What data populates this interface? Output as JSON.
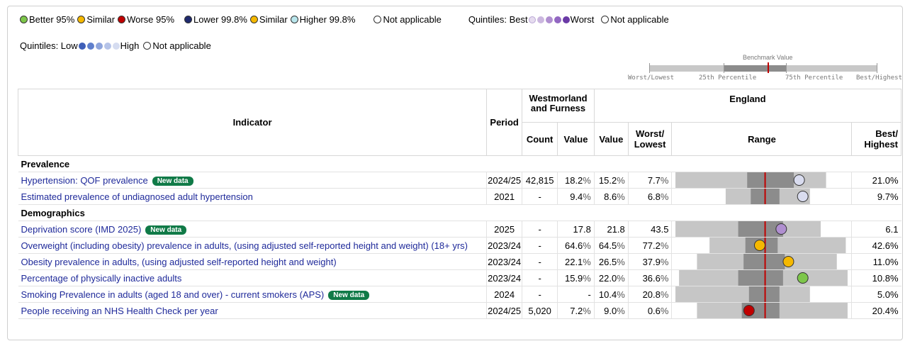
{
  "legend": {
    "row1": {
      "better": "Better 95%",
      "similar": "Similar",
      "worse": "Worse 95%",
      "lower": "Lower 99.8%",
      "similar2": "Similar",
      "higher": "Higher 99.8%",
      "not_applicable": "Not applicable",
      "quintiles_best_label": "Quintiles: Best",
      "quintiles_worst_label": "Worst",
      "not_applicable2": "Not applicable"
    },
    "row2": {
      "quintiles_low_label": "Quintiles: Low",
      "quintiles_high_label": "High",
      "not_applicable": "Not applicable"
    },
    "colors": {
      "better": "#7dc64a",
      "similar": "#f5b800",
      "worse": "#c00000",
      "lower": "#1f2a6e",
      "higher": "#b9e6ec",
      "best_quintiles": [
        "#e6dcef",
        "#cbb7df",
        "#b08fd0",
        "#9267c2",
        "#6a3aa6"
      ],
      "low_quintiles": [
        "#3f5fb8",
        "#5f7fcc",
        "#8fa5dc",
        "#b5c3e8",
        "#d5dcf0"
      ]
    }
  },
  "benchmark": {
    "title": "Benchmark Value",
    "worst": "Worst/Lowest",
    "p25": "25th Percentile",
    "p75": "75th Percentile",
    "best": "Best/Highest"
  },
  "headers": {
    "indicator": "Indicator",
    "period": "Period",
    "area": "Westmorland and Furness",
    "england": "England",
    "count": "Count",
    "value": "Value",
    "eng_value": "Value",
    "worst": "Worst/ Lowest",
    "range": "Range",
    "best": "Best/ Highest"
  },
  "new_data_label": "New data",
  "sections": [
    {
      "title": "Prevalence",
      "rows": [
        {
          "indicator": "Hypertension: QOF prevalence",
          "new": true,
          "period": "2024/25",
          "count": "42,815",
          "value": "18.2",
          "unit": "%",
          "eng": "15.2",
          "worst": "7.7",
          "best": "21.0",
          "dot": "#d9dcef",
          "range": {
            "outer": [
              0.02,
              0.86
            ],
            "inner": [
              0.42,
              0.68
            ],
            "mark": 0.52,
            "point": 0.71
          }
        },
        {
          "indicator": "Estimated prevalence of undiagnosed adult hypertension",
          "new": false,
          "period": "2021",
          "count": "-",
          "value": "9.4",
          "unit": "%",
          "eng": "8.6",
          "worst": "6.8",
          "best": "9.7",
          "dot": "#d9dcef",
          "range": {
            "outer": [
              0.3,
              0.77
            ],
            "inner": [
              0.44,
              0.6
            ],
            "mark": 0.52,
            "point": 0.73
          }
        }
      ]
    },
    {
      "title": "Demographics",
      "rows": [
        {
          "indicator": "Deprivation score (IMD 2025)",
          "new": true,
          "period": "2025",
          "count": "-",
          "value": "17.8",
          "unit": "",
          "eng": "21.8",
          "worst": "43.5",
          "best": "6.1",
          "dot": "#b08fd0",
          "range": {
            "outer": [
              0.02,
              0.83
            ],
            "inner": [
              0.37,
              0.62
            ],
            "mark": 0.52,
            "point": 0.61
          }
        },
        {
          "indicator": "Overweight (including obesity) prevalence in adults, (using adjusted self-reported height and weight) (18+ yrs)",
          "new": false,
          "period": "2023/24",
          "count": "-",
          "value": "64.6",
          "unit": "%",
          "eng": "64.5",
          "worst": "77.2",
          "best": "42.6",
          "dot": "#f5b800",
          "range": {
            "outer": [
              0.21,
              0.97
            ],
            "inner": [
              0.41,
              0.59
            ],
            "mark": 0.52,
            "point": 0.49
          }
        },
        {
          "indicator": "Obesity prevalence in adults, (using adjusted self-reported height and weight)",
          "new": false,
          "period": "2023/24",
          "count": "-",
          "value": "22.1",
          "unit": "%",
          "eng": "26.5",
          "worst": "37.9",
          "best": "11.0",
          "dot": "#f5b800",
          "range": {
            "outer": [
              0.14,
              0.92
            ],
            "inner": [
              0.4,
              0.63
            ],
            "mark": 0.52,
            "point": 0.65
          }
        },
        {
          "indicator": "Percentage of physically inactive adults",
          "new": false,
          "period": "2023/24",
          "count": "-",
          "value": "15.9",
          "unit": "%",
          "eng": "22.0",
          "worst": "36.6",
          "best": "10.8",
          "dot": "#7dc64a",
          "range": {
            "outer": [
              0.04,
              0.98
            ],
            "inner": [
              0.37,
              0.62
            ],
            "mark": 0.52,
            "point": 0.73
          }
        },
        {
          "indicator": "Smoking Prevalence in adults (aged 18 and over) - current smokers (APS)",
          "new": true,
          "period": "2024",
          "count": "-",
          "value": "-",
          "unit": "",
          "eng": "10.4",
          "worst": "20.8",
          "best": "5.0",
          "dot": "",
          "range": {
            "outer": [
              0.02,
              0.77
            ],
            "inner": [
              0.43,
              0.6
            ],
            "mark": 0.52,
            "point": null
          }
        },
        {
          "indicator": "People receiving an NHS Health Check per year",
          "new": false,
          "period": "2024/25",
          "count": "5,020",
          "value": "7.2",
          "unit": "%",
          "eng": "9.0",
          "worst": "0.6",
          "best": "20.4",
          "dot": "#c00000",
          "range": {
            "outer": [
              0.14,
              0.98
            ],
            "inner": [
              0.39,
              0.6
            ],
            "mark": 0.52,
            "point": 0.43
          }
        }
      ]
    }
  ]
}
